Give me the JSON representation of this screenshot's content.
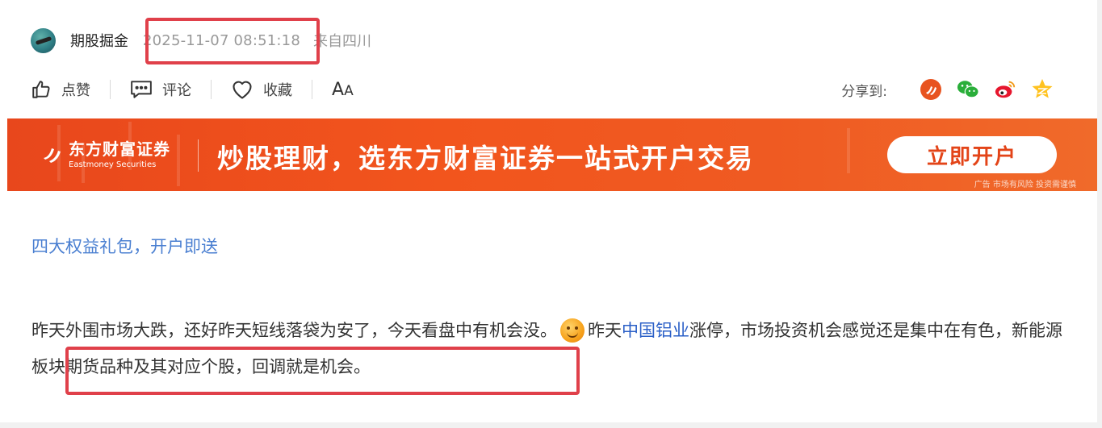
{
  "author": {
    "username": "期股掘金",
    "post_time": "2025-11-07 08:51:18",
    "location": "来自四川"
  },
  "toolbar": {
    "like_label": "点赞",
    "comment_label": "评论",
    "favorite_label": "收藏",
    "font_size_big": "A",
    "font_size_small": "A"
  },
  "share": {
    "label": "分享到:",
    "targets": [
      "eastmoney-icon",
      "wechat-icon",
      "weibo-icon",
      "qq-zone-icon"
    ]
  },
  "banner": {
    "logo_cn": "东方财富证券",
    "logo_en": "Eastmoney Securities",
    "slogan": "炒股理财，选东方财富证券一站式开户交易",
    "button_label": "立即开户",
    "ad_tag": "广告 市场有风险 投资需谨慎"
  },
  "content": {
    "promo_link": "四大权益礼包，开户即送",
    "para_part1": "昨天外围市场大跌，还好昨天短线落袋为安了，今天看盘中有机会没。",
    "para_part2": "昨天",
    "stock_link": "中国铝业",
    "para_part3": "涨停，市场投资机会感觉还是集中在有色，新能源板块期货品种及其对应个股，回调就是机会。"
  },
  "colors": {
    "highlight_border": "#e0404a",
    "link_blue": "#4a7fd1",
    "banner_orange": "#f2551d"
  }
}
